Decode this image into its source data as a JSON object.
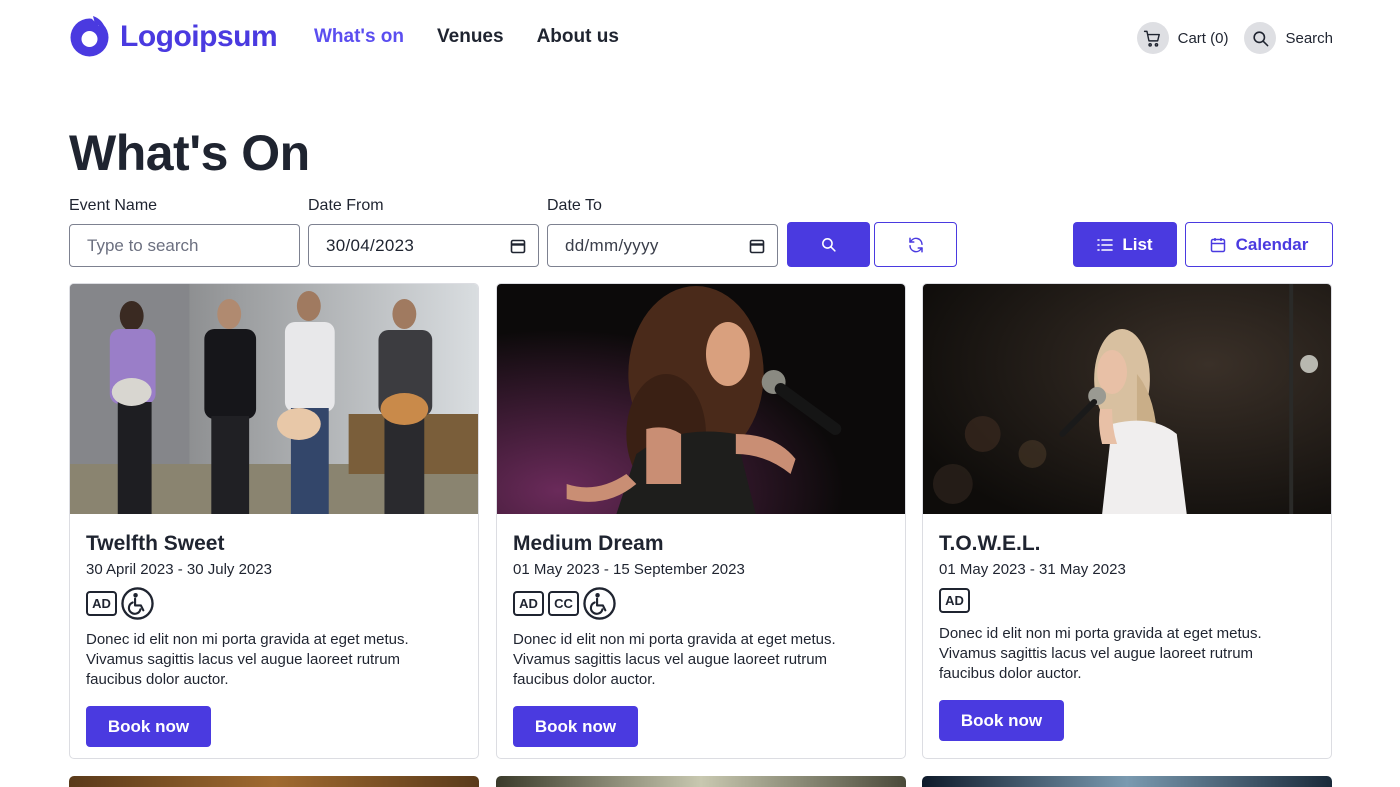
{
  "header": {
    "logo_text": "Logoipsum",
    "nav": [
      {
        "label": "What's on",
        "active": true
      },
      {
        "label": "Venues",
        "active": false
      },
      {
        "label": "About us",
        "active": false
      }
    ],
    "cart_label": "Cart (0)",
    "search_label": "Search"
  },
  "page": {
    "title": "What's On"
  },
  "filters": {
    "event_name_label": "Event Name",
    "event_name_placeholder": "Type to search",
    "event_name_value": "",
    "date_from_label": "Date From",
    "date_from_value": "30/04/2023",
    "date_to_label": "Date To",
    "date_to_value": "dd/mm/yyyy"
  },
  "view_toggle": {
    "list_label": "List",
    "calendar_label": "Calendar",
    "active": "List"
  },
  "colors": {
    "brand": "#4a3ae0",
    "nav_active": "#5b4ef0",
    "text": "#1f2430"
  },
  "events": [
    {
      "title": "Twelfth Sweet",
      "dates": "30 April 2023 - 30 July 2023",
      "badges": [
        "AD",
        "wheelchair"
      ],
      "badge_ad": "AD",
      "description": "Donec id elit non mi porta gravida at eget metus. Vivamus sagittis lacus vel augue laoreet rutrum faucibus dolor auctor.",
      "book_label": "Book now"
    },
    {
      "title": "Medium Dream",
      "dates": "01 May 2023 - 15 September 2023",
      "badges": [
        "AD",
        "CC",
        "wheelchair"
      ],
      "badge_ad": "AD",
      "badge_cc": "CC",
      "description": "Donec id elit non mi porta gravida at eget metus. Vivamus sagittis lacus vel augue laoreet rutrum faucibus dolor auctor.",
      "book_label": "Book now"
    },
    {
      "title": "T.O.W.E.L.",
      "dates": "01 May 2023 - 31 May 2023",
      "badges": [
        "AD"
      ],
      "badge_ad": "AD",
      "description": "Donec id elit non mi porta gravida at eget metus. Vivamus sagittis lacus vel augue laoreet rutrum faucibus dolor auctor.",
      "book_label": "Book now"
    }
  ]
}
